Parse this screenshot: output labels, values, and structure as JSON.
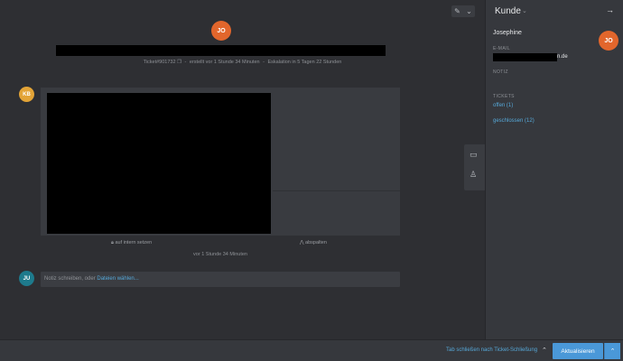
{
  "ticket": {
    "avatar_initials": "JO",
    "number": "Ticket#901732",
    "created": "erstellt vor 1 Stunde 34 Minuten",
    "escalation": "Eskalation in 5 Tagen 22 Stunden"
  },
  "article": {
    "avatar_initials": "KB",
    "internal_action": "auf intern setzen",
    "split_action": "abspalten",
    "time": "vor 1 Stunde 34 Minuten"
  },
  "note": {
    "avatar_initials": "JU",
    "placeholder": "Notiz schreiben, oder",
    "link": "Dateien wählen..."
  },
  "sidebar": {
    "title": "Kunde",
    "customer_name": "Josephine",
    "avatar_initials": "JO",
    "email_label": "E-MAIL",
    "email_suffix": "n.de",
    "notiz_label": "NOTIZ",
    "tickets_label": "TICKETS",
    "open_tickets": "offen (1)",
    "closed_tickets": "geschlossen (12)"
  },
  "footer": {
    "close_tab_label": "Tab schließen nach Ticket-Schließung",
    "update_button": "Aktualisieren"
  },
  "colors": {
    "accent": "#4a98d8",
    "link": "#56a8d8",
    "avatar_orange": "#e2662c",
    "avatar_yellow": "#e3a437",
    "avatar_teal": "#1e7a8c"
  }
}
